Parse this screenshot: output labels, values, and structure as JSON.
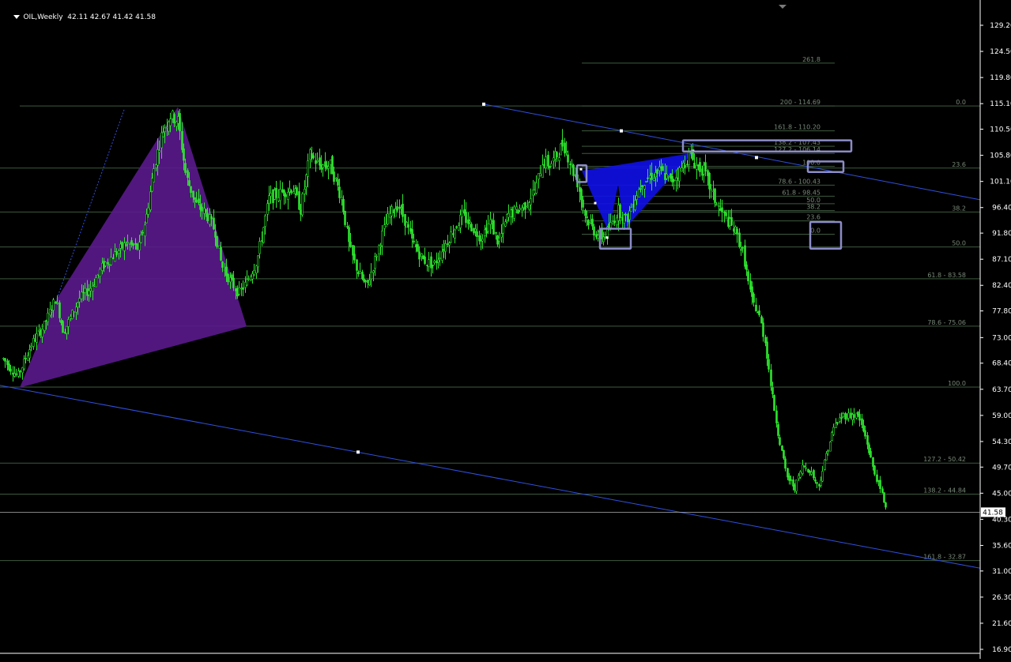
{
  "header": {
    "symbol": "OIL,Weekly",
    "ohlc": "42.11 42.67 41.42 41.58"
  },
  "colors": {
    "background": "#000000",
    "candle": "#2ee62e",
    "trendline": "#3050e0",
    "fib_line": "#3e5a3e",
    "fib_text": "#788878",
    "harmonic_pattern_1": "#5a1a8c",
    "harmonic_pattern_2": "#1010e8",
    "marker_box": "#8c8cc8",
    "axis_text": "#ffffff",
    "price_tag_bg": "#ffffff"
  },
  "chart_data": {
    "type": "candlestick",
    "timeframe": "Weekly",
    "current_price": "41.58",
    "current_price_value": 41.58,
    "y_ticks": [
      "129.20",
      "124.50",
      "119.80",
      "115.10",
      "110.50",
      "105.80",
      "101.10",
      "96.40",
      "91.80",
      "87.10",
      "82.40",
      "77.80",
      "73.00",
      "68.40",
      "63.70",
      "59.00",
      "54.30",
      "49.70",
      "45.00",
      "40.30",
      "35.60",
      "31.00",
      "26.30",
      "21.60",
      "16.90"
    ],
    "ylim": [
      16.9,
      129.2
    ],
    "price_series": [
      [
        0,
        70
      ],
      [
        10,
        68
      ],
      [
        22,
        66
      ],
      [
        40,
        72
      ],
      [
        55,
        75
      ],
      [
        70,
        80
      ],
      [
        80,
        74
      ],
      [
        100,
        80
      ],
      [
        115,
        82
      ],
      [
        130,
        86
      ],
      [
        145,
        88
      ],
      [
        160,
        90
      ],
      [
        175,
        89
      ],
      [
        185,
        95
      ],
      [
        195,
        104
      ],
      [
        205,
        110
      ],
      [
        215,
        113
      ],
      [
        225,
        112
      ],
      [
        235,
        102
      ],
      [
        248,
        97
      ],
      [
        262,
        95
      ],
      [
        272,
        92
      ],
      [
        280,
        86
      ],
      [
        292,
        83
      ],
      [
        302,
        81
      ],
      [
        312,
        83
      ],
      [
        325,
        87
      ],
      [
        340,
        98
      ],
      [
        355,
        99
      ],
      [
        370,
        100
      ],
      [
        380,
        96
      ],
      [
        392,
        106
      ],
      [
        403,
        104
      ],
      [
        418,
        104
      ],
      [
        432,
        98
      ],
      [
        442,
        89
      ],
      [
        452,
        85
      ],
      [
        463,
        82
      ],
      [
        472,
        86
      ],
      [
        482,
        91
      ],
      [
        492,
        95
      ],
      [
        503,
        97
      ],
      [
        512,
        94
      ],
      [
        522,
        90
      ],
      [
        535,
        87
      ],
      [
        548,
        86
      ],
      [
        560,
        89
      ],
      [
        572,
        92
      ],
      [
        585,
        95
      ],
      [
        596,
        93
      ],
      [
        608,
        91
      ],
      [
        620,
        94
      ],
      [
        630,
        90
      ],
      [
        642,
        95
      ],
      [
        655,
        96
      ],
      [
        665,
        97
      ],
      [
        678,
        100
      ],
      [
        686,
        105
      ],
      [
        695,
        104
      ],
      [
        705,
        106
      ],
      [
        712,
        108
      ],
      [
        720,
        105
      ],
      [
        730,
        101
      ],
      [
        740,
        95
      ],
      [
        752,
        92
      ],
      [
        762,
        91
      ],
      [
        772,
        93
      ],
      [
        782,
        96
      ],
      [
        792,
        94
      ],
      [
        802,
        98
      ],
      [
        812,
        101
      ],
      [
        822,
        102
      ],
      [
        835,
        103
      ],
      [
        848,
        101
      ],
      [
        860,
        103
      ],
      [
        872,
        106
      ],
      [
        880,
        104
      ],
      [
        890,
        103
      ],
      [
        900,
        99
      ],
      [
        910,
        96
      ],
      [
        920,
        94
      ],
      [
        930,
        92
      ],
      [
        940,
        88
      ],
      [
        950,
        80
      ],
      [
        960,
        77
      ],
      [
        968,
        72
      ],
      [
        976,
        63
      ],
      [
        985,
        55
      ],
      [
        995,
        48
      ],
      [
        1005,
        46
      ],
      [
        1015,
        50
      ],
      [
        1025,
        49
      ],
      [
        1035,
        46
      ],
      [
        1045,
        52
      ],
      [
        1055,
        57
      ],
      [
        1065,
        59
      ],
      [
        1075,
        59
      ],
      [
        1085,
        59
      ],
      [
        1095,
        55
      ],
      [
        1105,
        49
      ],
      [
        1115,
        45
      ],
      [
        1122,
        41.6
      ]
    ],
    "fib_lines": [
      {
        "label": "261.8",
        "price": 122.4,
        "x0": 736,
        "x1": 1056
      },
      {
        "label": "200 - 114.69",
        "price": 114.69,
        "x0": 736,
        "x1": 1056
      },
      {
        "label": "0.0",
        "price": 114.69,
        "x0": 25,
        "x1": 1240
      },
      {
        "label": "161.8 - 110.20",
        "price": 110.2,
        "x0": 736,
        "x1": 1056
      },
      {
        "label": "138.2 - 107.43",
        "price": 107.43,
        "x0": 736,
        "x1": 1056
      },
      {
        "label": "127.2 - 106.14",
        "price": 106.14,
        "x0": 736,
        "x1": 1056
      },
      {
        "label": "100.0",
        "price": 103.8,
        "x0": 736,
        "x1": 1056
      },
      {
        "label": "23.6",
        "price": 103.5,
        "x0": 0,
        "x1": 1240
      },
      {
        "label": "78.6 - 100.43",
        "price": 100.43,
        "x0": 736,
        "x1": 1056
      },
      {
        "label": "61.8 - 98.45",
        "price": 98.45,
        "x0": 736,
        "x1": 1056
      },
      {
        "label": "50.0",
        "price": 97.1,
        "x0": 736,
        "x1": 1056
      },
      {
        "label": "38.2",
        "price": 95.85,
        "x0": 736,
        "x1": 1056
      },
      {
        "label": "38.2",
        "price": 95.6,
        "x0": 0,
        "x1": 1240
      },
      {
        "label": "23.6",
        "price": 94.0,
        "x0": 736,
        "x1": 1056
      },
      {
        "label": "0.0",
        "price": 91.6,
        "x0": 736,
        "x1": 1056
      },
      {
        "label": "50.0",
        "price": 89.3,
        "x0": 0,
        "x1": 1240
      },
      {
        "label": "61.8 - 83.58",
        "price": 83.58,
        "x0": 0,
        "x1": 1240
      },
      {
        "label": "78.6 - 75.06",
        "price": 75.06,
        "x0": 0,
        "x1": 1240
      },
      {
        "label": "100.0",
        "price": 64.1,
        "x0": 0,
        "x1": 1240
      },
      {
        "label": "127.2 - 50.42",
        "price": 50.42,
        "x0": 0,
        "x1": 1240
      },
      {
        "label": "138.2 - 44.84",
        "price": 44.84,
        "x0": 0,
        "x1": 1240
      },
      {
        "label": "161.8 - 32.87",
        "price": 32.87,
        "x0": 0,
        "x1": 1240
      }
    ],
    "trendlines": [
      {
        "name": "upper-channel",
        "p1": [
          612,
          115.0
        ],
        "p2": [
          1240,
          97.8
        ],
        "anchors": [
          [
            612,
            115.0
          ],
          [
            786,
            110.2
          ],
          [
            957,
            105.4
          ]
        ]
      },
      {
        "name": "lower-channel",
        "p1": [
          0,
          64.4
        ],
        "p2": [
          1240,
          31.5
        ],
        "anchors": [
          [
            453,
            52.4
          ]
        ]
      }
    ],
    "patterns": [
      {
        "name": "bat-pattern-1",
        "points": [
          [
            25,
            64.0
          ],
          [
            72,
            80.0
          ],
          [
            225,
            114.5
          ],
          [
            312,
            75.0
          ]
        ]
      },
      {
        "name": "bat-pattern-2",
        "points": [
          [
            736,
            103.0
          ],
          [
            770,
            92.0
          ],
          [
            782,
            100.5
          ],
          [
            790,
            92.5
          ],
          [
            876,
            106.2
          ]
        ]
      }
    ],
    "marker_boxes": [
      {
        "x0": 730,
        "x1": 742,
        "p0": 104.0,
        "p1": 101.0
      },
      {
        "x0": 759,
        "x1": 798,
        "p0": 92.6,
        "p1": 89.0
      },
      {
        "x0": 864,
        "x1": 1077,
        "p0": 108.5,
        "p1": 106.5
      },
      {
        "x0": 1022,
        "x1": 1067,
        "p0": 104.7,
        "p1": 102.8
      },
      {
        "x0": 1025,
        "x1": 1064,
        "p0": 93.8,
        "p1": 89.0
      }
    ]
  }
}
